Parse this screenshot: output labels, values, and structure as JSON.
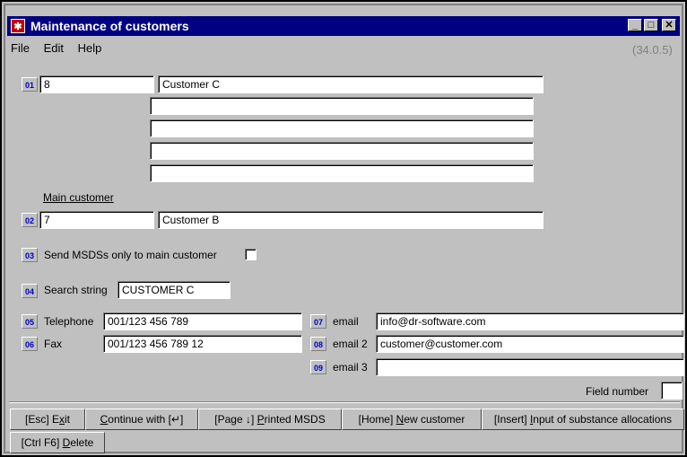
{
  "window": {
    "title": "Maintenance of customers",
    "app_icon": "red-app-icon",
    "controls": [
      "minimize",
      "maximize",
      "close"
    ]
  },
  "menu": {
    "file": "File",
    "edit": "Edit",
    "help": "Help"
  },
  "version": "(34.0.5)",
  "fields": {
    "f01": {
      "number": "01",
      "id_value": "8",
      "name_value": "Customer C",
      "extra_lines": [
        "",
        "",
        "",
        ""
      ]
    },
    "main_customer_label": "Main customer",
    "f02": {
      "number": "02",
      "id_value": "7",
      "name_value": "Customer B"
    },
    "f03": {
      "number": "03",
      "label": "Send MSDSs only to main customer",
      "checked": false
    },
    "f04": {
      "number": "04",
      "label": "Search string",
      "value": "CUSTOMER C"
    },
    "f05": {
      "number": "05",
      "label": "Telephone",
      "value": "001/123 456 789"
    },
    "f06": {
      "number": "06",
      "label": "Fax",
      "value": "001/123 456 789 12"
    },
    "f07": {
      "number": "07",
      "label": "email",
      "value": "info@dr-software.com"
    },
    "f08": {
      "number": "08",
      "label": "email 2",
      "value": "customer@customer.com"
    },
    "f09": {
      "number": "09",
      "label": "email 3",
      "value": ""
    },
    "field_number": {
      "label": "Field number",
      "value": ""
    }
  },
  "buttons": {
    "exit": {
      "prefix": "[Esc] E",
      "accel": "x",
      "suffix": "it"
    },
    "continue": {
      "prefix": "",
      "accel": "C",
      "suffix": "ontinue with [↵]"
    },
    "printed": {
      "prefix": "[Page ↓] ",
      "accel": "P",
      "suffix": "rinted MSDS"
    },
    "new_customer": {
      "prefix": "[Home] ",
      "accel": "N",
      "suffix": "ew customer"
    },
    "input_alloc": {
      "prefix": "[Insert] ",
      "accel": "I",
      "suffix": "nput of substance allocations"
    },
    "delete": {
      "prefix": "[Ctrl F6] ",
      "accel": "D",
      "suffix": "elete"
    }
  }
}
